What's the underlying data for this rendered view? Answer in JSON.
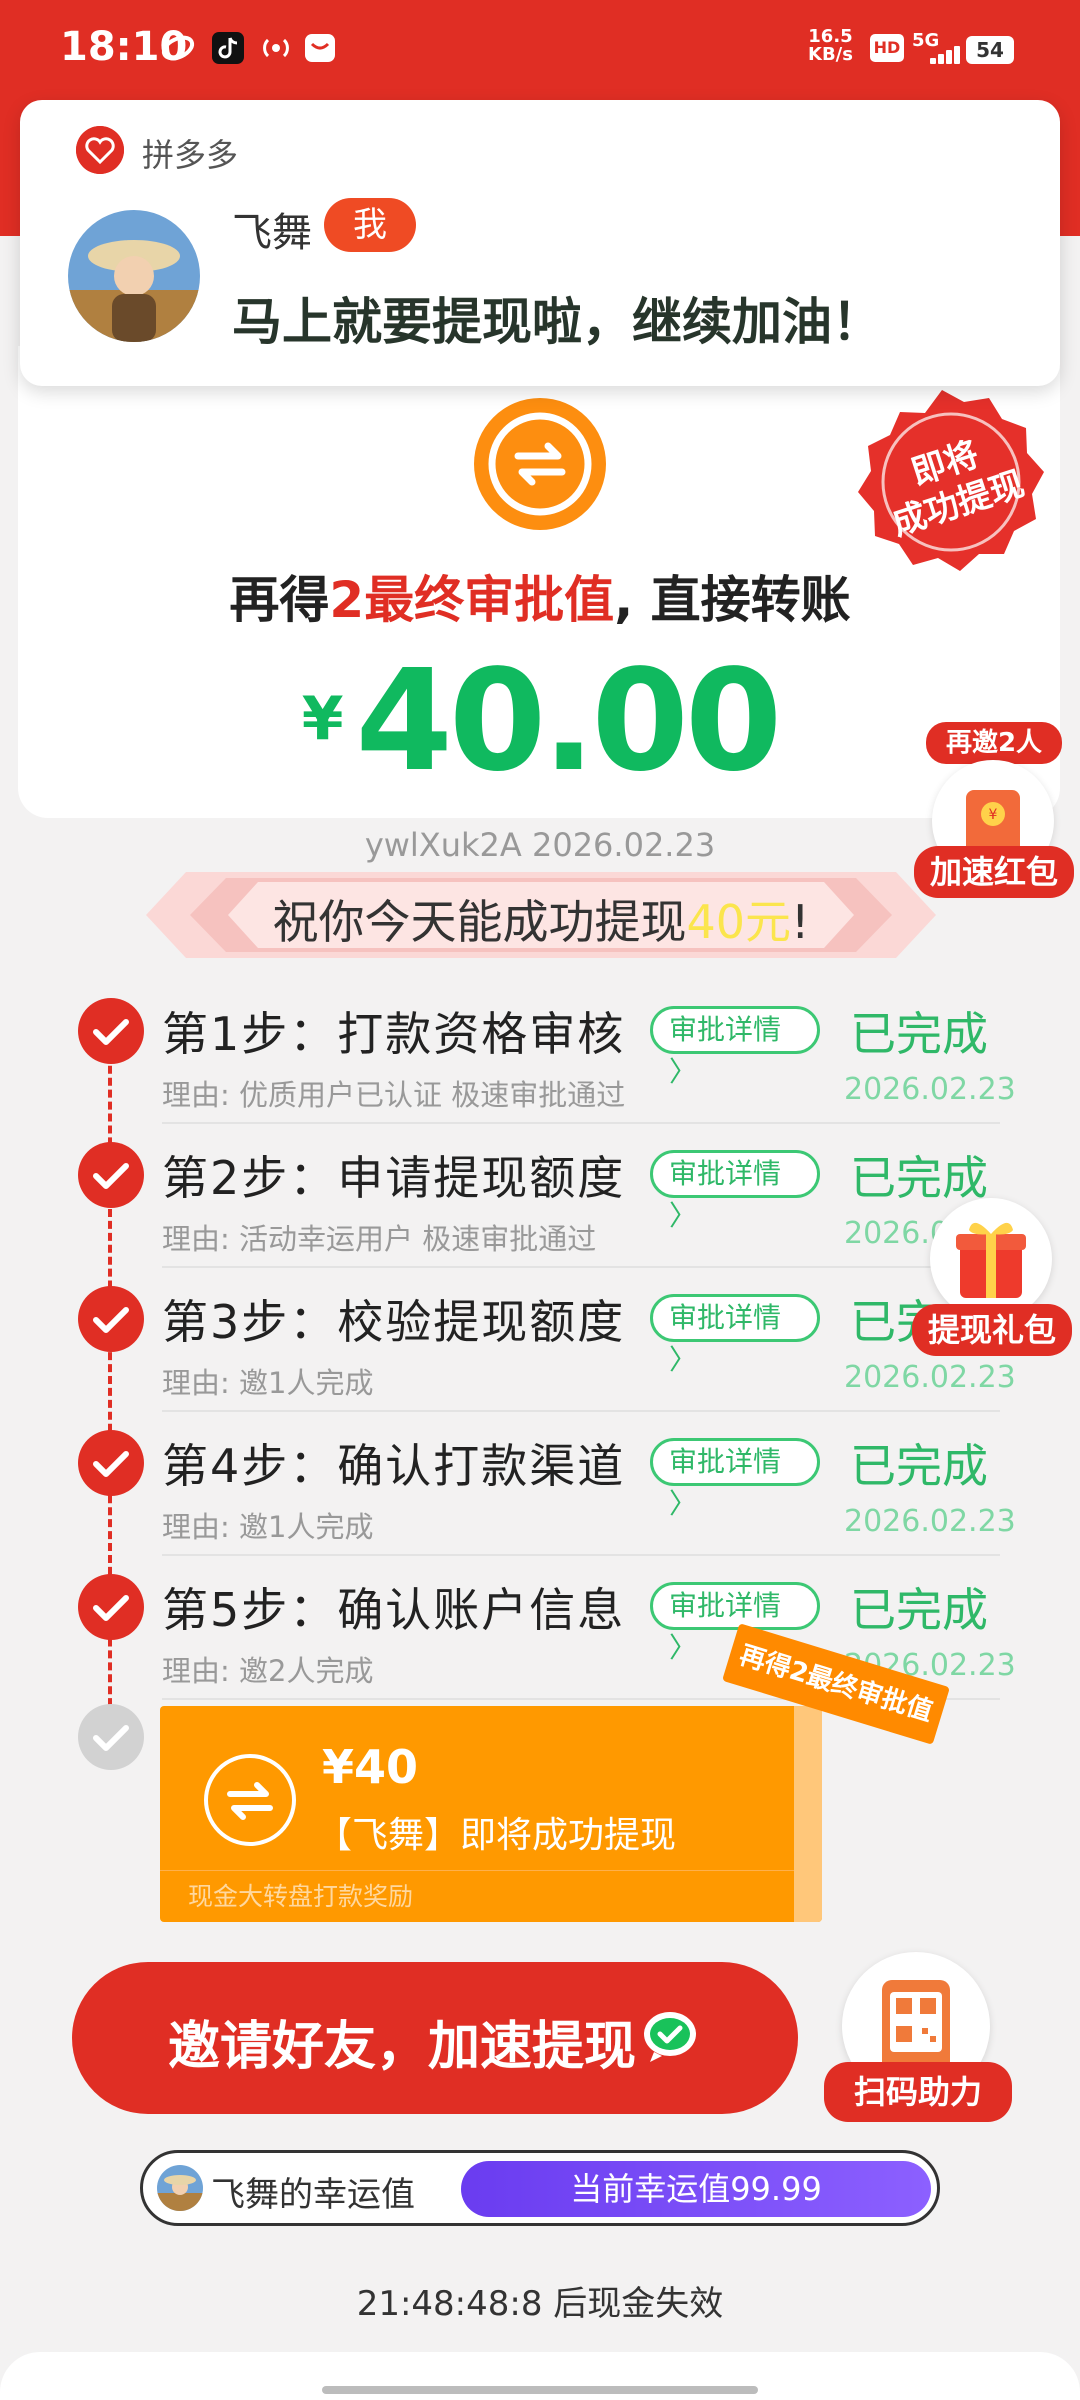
{
  "status_bar": {
    "time": "18:10",
    "net_speed_value": "16.5",
    "net_speed_unit": "KB/s",
    "hd": "HD",
    "network": "5G",
    "battery": "54",
    "icons": [
      "pinduoduo-icon",
      "tiktok-icon",
      "hotspot-icon",
      "message-icon"
    ]
  },
  "notification": {
    "app_name": "拼多多",
    "sender": "飞舞",
    "badge": "我",
    "message": "马上就要提现啦，继续加油！"
  },
  "main": {
    "headline_prefix": "再得",
    "headline_number": "2",
    "headline_highlight": "最终审批值",
    "headline_suffix": ", 直接转账",
    "currency": "¥",
    "amount": "40.00",
    "seal_line1": "即将",
    "seal_line2": "成功提现",
    "user_date": "ywlXuk2A 2026.02.23",
    "banner_prefix": "祝你今天能成功提现",
    "banner_highlight": "40元",
    "banner_suffix": "!"
  },
  "side_badges": {
    "invite_top": "再邀2人",
    "invite_label": "加速红包",
    "gift_label": "提现礼包",
    "qr_label": "扫码助力"
  },
  "steps": [
    {
      "title": "第1步：打款资格审核",
      "detail": "审批详情",
      "status": "已完成",
      "reason": "理由: 优质用户已认证 极速审批通过",
      "date": "2026.02.23"
    },
    {
      "title": "第2步：申请提现额度",
      "detail": "审批详情",
      "status": "已完成",
      "reason": "理由: 活动幸运用户 极速审批通过",
      "date": "2026.0"
    },
    {
      "title": "第3步：校验提现额度",
      "detail": "审批详情",
      "status": "已完",
      "reason": "理由: 邀1人完成",
      "date": "2026.02.23"
    },
    {
      "title": "第4步：确认打款渠道",
      "detail": "审批详情",
      "status": "已完成",
      "reason": "理由: 邀1人完成",
      "date": "2026.02.23"
    },
    {
      "title": "第5步：确认账户信息",
      "detail": "审批详情",
      "status": "已完成",
      "reason": "理由: 邀2人完成",
      "date": "2026.02.23"
    }
  ],
  "final_card": {
    "amount": "¥40",
    "text": "【飞舞】即将成功提现",
    "footer": "现金大转盘打款奖励",
    "ribbon": "再得2最终审批值"
  },
  "invite_button": "邀请好友，加速提现",
  "lucky": {
    "name": "飞舞的幸运值",
    "value": "当前幸运值99.99"
  },
  "countdown": "21:48:48:8 后现金失效",
  "colors": {
    "brand_red": "#e02e24",
    "green": "#10b95f",
    "orange": "#ff9900",
    "purple": "#6a3cf0"
  }
}
